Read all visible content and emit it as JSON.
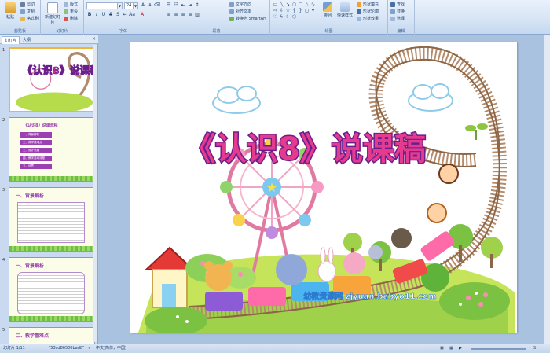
{
  "ribbon": {
    "clipboard": {
      "label": "剪贴板",
      "paste": "粘贴",
      "cut": "剪切",
      "copy": "复制",
      "format_painter": "格式刷"
    },
    "slides": {
      "label": "幻灯片",
      "new_slide": "新建幻灯片",
      "layout": "版式",
      "reset": "重设",
      "delete": "删除"
    },
    "font": {
      "label": "字体",
      "font_size": "24"
    },
    "paragraph": {
      "label": "段落",
      "text_direction": "文字方向",
      "align_text": "对齐文本",
      "smartart": "转换为 SmartArt"
    },
    "drawing": {
      "label": "绘图",
      "arrange": "排列",
      "quick_styles": "快速样式",
      "shape_fill": "形状填充",
      "shape_outline": "形状轮廓",
      "shape_effects": "形状效果"
    },
    "editing": {
      "label": "编辑",
      "find": "查找",
      "replace": "替换",
      "select": "选择"
    }
  },
  "pane": {
    "tab_slides": "幻灯片",
    "tab_outline": "大纲",
    "close": "×",
    "slides": [
      {
        "num": "1"
      },
      {
        "num": "2",
        "title": "《认识8》说课流程",
        "items": [
          "一、背景解析",
          "二、教学重难点",
          "三、设计思路",
          "四、教学活动流程",
          "五、反思"
        ]
      },
      {
        "num": "3",
        "title": "一、背景解析"
      },
      {
        "num": "4",
        "title": "一、背景解析"
      },
      {
        "num": "5",
        "title": "二、教学重难点"
      }
    ]
  },
  "slide": {
    "title": "《认识8》说课稿",
    "watermark": "幼教资源网 zjyuan.babyo11.com"
  },
  "status": {
    "slide_counter": "幻灯片 1/11",
    "theme": "\"53cd86500bad8\"",
    "language": "中文(简体，中国)"
  },
  "colors": {
    "title_fill": "#e43a8f",
    "title_outline": "#6b1f8c",
    "accent_selected": "#f2b33d",
    "thumb_purple": "#9b3fb3"
  }
}
